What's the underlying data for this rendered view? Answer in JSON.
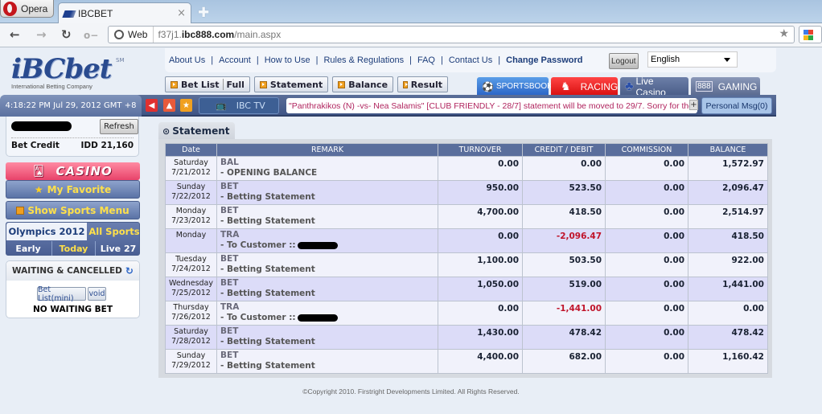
{
  "browser": {
    "menu_label": "Opera",
    "tab_title": "IBCBET",
    "address_mode": "Web",
    "url_prefix": "f37j1.",
    "url_domain": "ibc888.com",
    "url_path": "/main.aspx"
  },
  "brand": {
    "logo_text": "iBCbet",
    "logo_mark": "SM",
    "tagline": "International Betting Company"
  },
  "top_links": [
    "About Us",
    "Account",
    "How to Use",
    "Rules & Regulations",
    "FAQ",
    "Contact Us"
  ],
  "change_password": "Change Password",
  "logout_label": "Logout",
  "language": "English",
  "action_buttons": {
    "bet_list": "Bet List",
    "full": "Full",
    "statement": "Statement",
    "balance": "Balance",
    "result": "Result"
  },
  "product_tabs": {
    "sportsbook": "SPORTSBOOK",
    "racing": "RACING",
    "live_casino": "Live Casino",
    "gaming": "GAMING",
    "gaming_badge": "888"
  },
  "clock": "4:18:22 PM Jul 29, 2012 GMT +8",
  "ibc_tv": "IBC TV",
  "ticker": "\"Panthrakikos (N) -vs- Nea Salamis\" [CLUB FRIENDLY - 28/7] statement will be moved to 29/7. Sorry for the",
  "personal_msg": "Personal Msg(0)",
  "account": {
    "refresh_label": "Refresh",
    "bet_credit_label": "Bet Credit",
    "bet_credit_value": "IDD 21,160"
  },
  "sidebar": {
    "casino": "CASINO",
    "my_favorite": "My Favorite",
    "show_sports_menu": "Show Sports Menu",
    "olympics": "Olympics 2012",
    "all_sports": "All Sports",
    "early": "Early",
    "today": "Today",
    "live": "Live 27",
    "waiting_title": "WAITING & CANCELLED",
    "bet_list_mini": "Bet List(mini)",
    "void": "void",
    "no_waiting": "NO WAITING BET"
  },
  "statement": {
    "title": "Statement",
    "columns": [
      "Date",
      "REMARK",
      "TURNOVER",
      "CREDIT / DEBIT",
      "COMMISSION",
      "BALANCE"
    ],
    "rows": [
      {
        "day": "Saturday",
        "date": "7/21/2012",
        "type": "BAL",
        "desc": "- OPENING BALANCE",
        "turnover": "0.00",
        "credit": "0.00",
        "commission": "0.00",
        "balance": "1,572.97",
        "negative": false
      },
      {
        "day": "Sunday",
        "date": "7/22/2012",
        "type": "BET",
        "desc": "- Betting Statement",
        "turnover": "950.00",
        "credit": "523.50",
        "commission": "0.00",
        "balance": "2,096.47",
        "negative": false
      },
      {
        "day": "Monday",
        "date": "7/23/2012",
        "type": "BET",
        "desc": "- Betting Statement",
        "turnover": "4,700.00",
        "credit": "418.50",
        "commission": "0.00",
        "balance": "2,514.97",
        "negative": false
      },
      {
        "day": "Monday",
        "date": "",
        "type": "TRA",
        "desc": "- To Customer ::",
        "turnover": "0.00",
        "credit": "-2,096.47",
        "commission": "0.00",
        "balance": "418.50",
        "negative": true
      },
      {
        "day": "Tuesday",
        "date": "7/24/2012",
        "type": "BET",
        "desc": "- Betting Statement",
        "turnover": "1,100.00",
        "credit": "503.50",
        "commission": "0.00",
        "balance": "922.00",
        "negative": false
      },
      {
        "day": "Wednesday",
        "date": "7/25/2012",
        "type": "BET",
        "desc": "- Betting Statement",
        "turnover": "1,050.00",
        "credit": "519.00",
        "commission": "0.00",
        "balance": "1,441.00",
        "negative": false
      },
      {
        "day": "Thursday",
        "date": "7/26/2012",
        "type": "TRA",
        "desc": "- To Customer ::",
        "turnover": "0.00",
        "credit": "-1,441.00",
        "commission": "0.00",
        "balance": "0.00",
        "negative": true
      },
      {
        "day": "Saturday",
        "date": "7/28/2012",
        "type": "BET",
        "desc": "- Betting Statement",
        "turnover": "1,430.00",
        "credit": "478.42",
        "commission": "0.00",
        "balance": "478.42",
        "negative": false
      },
      {
        "day": "Sunday",
        "date": "7/29/2012",
        "type": "BET",
        "desc": "- Betting Statement",
        "turnover": "4,400.00",
        "credit": "682.00",
        "commission": "0.00",
        "balance": "1,160.42",
        "negative": false
      }
    ]
  },
  "footer": "©Copyright 2010. Firstright Developments Limited. All Rights Reserved."
}
